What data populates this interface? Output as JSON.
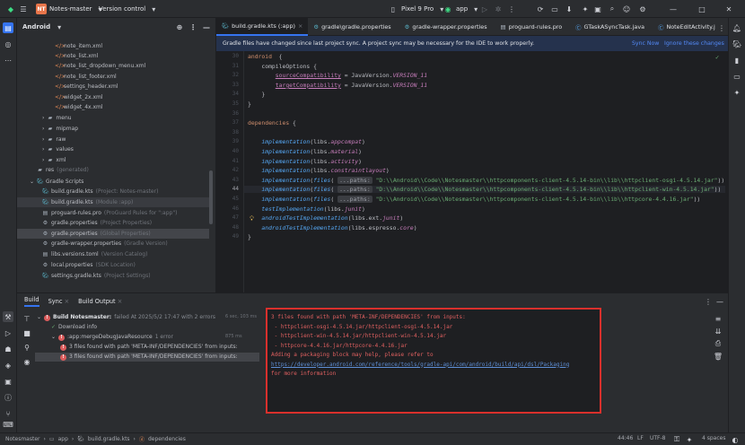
{
  "titlebar": {
    "project_badge": "NT",
    "project_name": "Notes-master",
    "vcs": "Version control",
    "device": "Pixel 9 Pro",
    "run_config": "app"
  },
  "project_panel": {
    "title": "Android",
    "items": [
      {
        "label": "note_item.xml",
        "suffix": "",
        "icon": "xml"
      },
      {
        "label": "note_list.xml",
        "suffix": "",
        "icon": "xml"
      },
      {
        "label": "note_list_dropdown_menu.xml",
        "suffix": "",
        "icon": "xml"
      },
      {
        "label": "note_list_footer.xml",
        "suffix": "",
        "icon": "xml"
      },
      {
        "label": "settings_header.xml",
        "suffix": "",
        "icon": "xml"
      },
      {
        "label": "widget_2x.xml",
        "suffix": "",
        "icon": "xml"
      },
      {
        "label": "widget_4x.xml",
        "suffix": "",
        "icon": "xml"
      },
      {
        "label": "menu",
        "suffix": "",
        "icon": "folder"
      },
      {
        "label": "mipmap",
        "suffix": "",
        "icon": "folder"
      },
      {
        "label": "raw",
        "suffix": "",
        "icon": "folder"
      },
      {
        "label": "values",
        "suffix": "",
        "icon": "folder"
      },
      {
        "label": "xml",
        "suffix": "",
        "icon": "folder"
      },
      {
        "label": "res",
        "suffix": "(generated)",
        "icon": "folder"
      },
      {
        "label": "Gradle Scripts",
        "suffix": "",
        "icon": "gradle"
      },
      {
        "label": "build.gradle.kts",
        "suffix": "(Project: Notes-master)",
        "icon": "gradle"
      },
      {
        "label": "build.gradle.kts",
        "suffix": "(Module :app)",
        "icon": "gradle"
      },
      {
        "label": "proguard-rules.pro",
        "suffix": "(ProGuard Rules for \":app\")",
        "icon": "file"
      },
      {
        "label": "gradle.properties",
        "suffix": "(Project Properties)",
        "icon": "gear"
      },
      {
        "label": "gradle.properties",
        "suffix": "(Global Properties)",
        "icon": "gear"
      },
      {
        "label": "gradle-wrapper.properties",
        "suffix": "(Gradle Version)",
        "icon": "gear"
      },
      {
        "label": "libs.versions.toml",
        "suffix": "(Version Catalog)",
        "icon": "file"
      },
      {
        "label": "local.properties",
        "suffix": "(SDK Location)",
        "icon": "gear"
      },
      {
        "label": "settings.gradle.kts",
        "suffix": "(Project Settings)",
        "icon": "gradle"
      }
    ]
  },
  "tabs": [
    {
      "label": "build.gradle.kts (:app)",
      "active": true
    },
    {
      "label": "gradle\\gradle.properties",
      "active": false
    },
    {
      "label": "gradle-wrapper.properties",
      "active": false
    },
    {
      "label": "proguard-rules.pro",
      "active": false
    },
    {
      "label": "GTaskASyncTask.java",
      "active": false
    },
    {
      "label": "NoteEditActivity.j",
      "active": false
    }
  ],
  "banner": {
    "message": "Gradle files have changed since last project sync. A project sync may be necessary for the IDE to work properly.",
    "sync_now": "Sync Now",
    "ignore": "Ignore these changes"
  },
  "editor": {
    "current_line": "44",
    "lines": [
      {
        "n": "30",
        "segs": [
          [
            "kw",
            "android"
          ],
          [
            "",
            "  {"
          ]
        ]
      },
      {
        "n": "31",
        "segs": [
          [
            "",
            "    compileOptions {"
          ]
        ]
      },
      {
        "n": "32",
        "segs": [
          [
            "",
            "        "
          ],
          [
            "prop",
            "sourceCompatibility"
          ],
          [
            "",
            " = JavaVersion."
          ],
          [
            "cst",
            "VERSION_11"
          ]
        ]
      },
      {
        "n": "33",
        "segs": [
          [
            "",
            "        "
          ],
          [
            "prop",
            "targetCompatibility"
          ],
          [
            "",
            " = JavaVersion."
          ],
          [
            "cst",
            "VERSION_11"
          ]
        ]
      },
      {
        "n": "34",
        "segs": [
          [
            "",
            "    }"
          ]
        ]
      },
      {
        "n": "35",
        "segs": [
          [
            "",
            "}"
          ]
        ]
      },
      {
        "n": "36",
        "segs": [
          [
            "",
            ""
          ]
        ]
      },
      {
        "n": "37",
        "segs": [
          [
            "kw",
            "dependencies"
          ],
          [
            "",
            " {"
          ]
        ]
      },
      {
        "n": "38",
        "segs": [
          [
            "",
            ""
          ]
        ]
      },
      {
        "n": "39",
        "segs": [
          [
            "",
            "    "
          ],
          [
            "fn",
            "implementation"
          ],
          [
            "",
            "(libs."
          ],
          [
            "cst",
            "appcompat"
          ],
          [
            "",
            ")"
          ]
        ]
      },
      {
        "n": "40",
        "segs": [
          [
            "",
            "    "
          ],
          [
            "fn",
            "implementation"
          ],
          [
            "",
            "(libs."
          ],
          [
            "cst",
            "material"
          ],
          [
            "",
            ")"
          ]
        ]
      },
      {
        "n": "41",
        "segs": [
          [
            "",
            "    "
          ],
          [
            "fn",
            "implementation"
          ],
          [
            "",
            "(libs."
          ],
          [
            "cst",
            "activity"
          ],
          [
            "",
            ")"
          ]
        ]
      },
      {
        "n": "42",
        "segs": [
          [
            "",
            "    "
          ],
          [
            "fn",
            "implementation"
          ],
          [
            "",
            "(libs."
          ],
          [
            "cst",
            "constraintlayout"
          ],
          [
            "",
            ")"
          ]
        ]
      },
      {
        "n": "43",
        "segs": [
          [
            "",
            "    "
          ],
          [
            "fn",
            "implementation"
          ],
          [
            "",
            "("
          ],
          [
            "fn",
            "files"
          ],
          [
            "",
            "( "
          ],
          [
            "hint",
            "...paths:"
          ],
          [
            "",
            " "
          ],
          [
            "str",
            "\"D:\\\\Android\\\\Code\\\\Notesmaster\\\\httpcomponents-client-4.5.14-bin\\\\lib\\\\httpclient-osgi-4.5.14.jar\""
          ],
          [
            "",
            "))"
          ]
        ]
      },
      {
        "n": "44",
        "segs": [
          [
            "",
            "    "
          ],
          [
            "fn",
            "implementation"
          ],
          [
            "",
            "("
          ],
          [
            "fn",
            "files"
          ],
          [
            "",
            "( "
          ],
          [
            "hint",
            "...paths:"
          ],
          [
            "",
            " "
          ],
          [
            "str",
            "\"D:\\\\Android\\\\Code\\\\Notesmaster\\\\httpcomponents-client-4.5.14-bin\\\\lib\\\\httpclient-win-4.5.14.jar\""
          ],
          [
            "",
            "))"
          ]
        ]
      },
      {
        "n": "45",
        "segs": [
          [
            "",
            "    "
          ],
          [
            "fn",
            "implementation"
          ],
          [
            "",
            "("
          ],
          [
            "fn",
            "files"
          ],
          [
            "",
            "( "
          ],
          [
            "hint",
            "...paths:"
          ],
          [
            "",
            " "
          ],
          [
            "str",
            "\"D:\\\\Android\\\\Code\\\\Notesmaster\\\\httpcomponents-client-4.5.14-bin\\\\lib\\\\httpcore-4.4.16.jar\""
          ],
          [
            "",
            "))"
          ]
        ]
      },
      {
        "n": "46",
        "segs": [
          [
            "",
            "    "
          ],
          [
            "fn",
            "testImplementation"
          ],
          [
            "",
            "(libs."
          ],
          [
            "cst",
            "junit"
          ],
          [
            "",
            ")"
          ]
        ]
      },
      {
        "n": "47",
        "segs": [
          [
            "",
            "    "
          ],
          [
            "fn",
            "androidTestImplementation"
          ],
          [
            "",
            "(libs.ext."
          ],
          [
            "cst",
            "junit"
          ],
          [
            "",
            ")"
          ]
        ]
      },
      {
        "n": "48",
        "segs": [
          [
            "",
            "    "
          ],
          [
            "fn",
            "androidTestImplementation"
          ],
          [
            "",
            "(libs.espresso."
          ],
          [
            "cst",
            "core"
          ],
          [
            "",
            ")"
          ]
        ]
      },
      {
        "n": "49",
        "segs": [
          [
            "",
            "}"
          ]
        ]
      }
    ]
  },
  "bottom": {
    "tabs": [
      "Build",
      "Sync",
      "Build Output"
    ],
    "tree": [
      {
        "label": "Build Notesmaster:",
        "detail": "failed At 2025/5/2 17:47 with 2 errors",
        "time": "6 sec, 103 ms",
        "icon": "error"
      },
      {
        "label": "Download info",
        "detail": "",
        "time": "",
        "icon": "download"
      },
      {
        "label": ":app:mergeDebugJavaResource",
        "detail": "1 error",
        "time": "875 ms",
        "icon": "error"
      },
      {
        "label": "3 files found with path 'META-INF/DEPENDENCIES' from inputs:",
        "detail": "",
        "time": "",
        "icon": "error"
      },
      {
        "label": "3 files found with path 'META-INF/DEPENDENCIES' from inputs:",
        "detail": "",
        "time": "",
        "icon": "error"
      }
    ],
    "output": [
      "3 files found with path 'META-INF/DEPENDENCIES' from inputs:",
      " - httpclient-osgi-4.5.14.jar/httpclient-osgi-4.5.14.jar",
      " - httpclient-win-4.5.14.jar/httpclient-win-4.5.14.jar",
      " - httpcore-4.4.16.jar/httpcore-4.4.16.jar",
      "Adding a packaging block may help, please refer to",
      "https://developer.android.com/reference/tools/gradle-api/com/android/build/api/dsl/Packaging",
      "for more information"
    ]
  },
  "statusbar": {
    "crumbs": [
      "Notesmaster",
      "app",
      "build.gradle.kts",
      "dependencies"
    ],
    "position": "44:46",
    "line_sep": "LF",
    "encoding": "UTF-8",
    "indent": "4 spaces"
  }
}
